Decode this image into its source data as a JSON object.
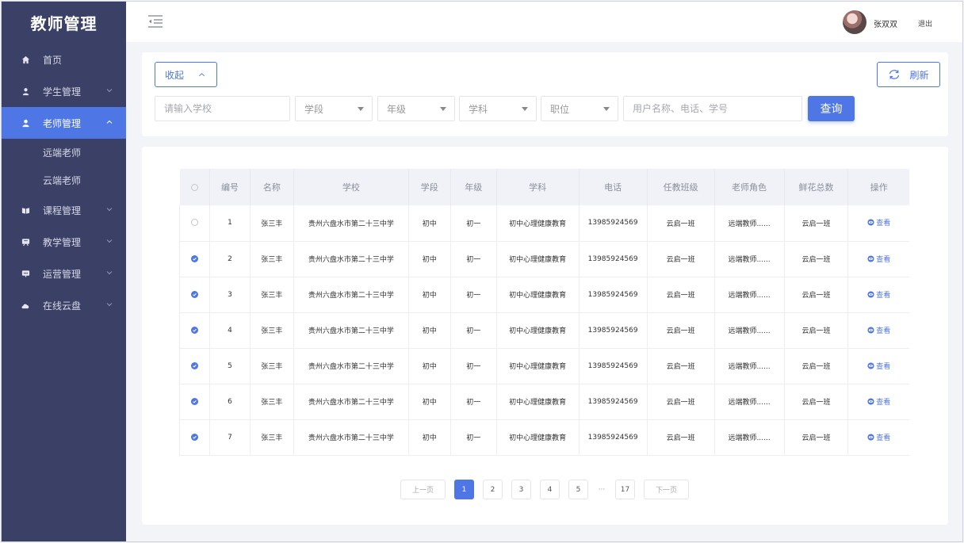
{
  "sidebar": {
    "brand": "教师管理",
    "items": [
      {
        "label": "首页"
      },
      {
        "label": "学生管理"
      },
      {
        "label": "老师管理"
      },
      {
        "label": "课程管理"
      },
      {
        "label": "教学管理"
      },
      {
        "label": "运营管理"
      },
      {
        "label": "在线云盘"
      }
    ],
    "subitems": [
      {
        "label": "远端老师"
      },
      {
        "label": "云端老师"
      }
    ]
  },
  "topbar": {
    "username": "张双双",
    "logout": "退出"
  },
  "filters": {
    "collapse_label": "收起",
    "refresh_label": "刷新",
    "school_placeholder": "请输入学校",
    "stage": "学段",
    "grade": "年级",
    "subject": "学科",
    "position": "职位",
    "keyword_placeholder": "用户名称、电话、学号",
    "search_label": "查询"
  },
  "table": {
    "headers": [
      "编号",
      "名称",
      "学校",
      "学段",
      "年级",
      "学科",
      "电话",
      "任教班级",
      "老师角色",
      "鲜花总数",
      "操作"
    ],
    "rows": [
      {
        "checked": false,
        "id": "1",
        "name": "张三丰",
        "school": "贵州六盘水市第二十三中学",
        "stage": "初中",
        "grade": "初一",
        "subject": "初中心理健康教育",
        "phone": "13985924569",
        "class": "云启一班",
        "role": "远端教师......",
        "flowers": "云启一班",
        "action": "查看"
      },
      {
        "checked": true,
        "id": "2",
        "name": "张三丰",
        "school": "贵州六盘水市第二十三中学",
        "stage": "初中",
        "grade": "初一",
        "subject": "初中心理健康教育",
        "phone": "13985924569",
        "class": "云启一班",
        "role": "远端教师......",
        "flowers": "云启一班",
        "action": "查看"
      },
      {
        "checked": true,
        "id": "3",
        "name": "张三丰",
        "school": "贵州六盘水市第二十三中学",
        "stage": "初中",
        "grade": "初一",
        "subject": "初中心理健康教育",
        "phone": "13985924569",
        "class": "云启一班",
        "role": "远端教师......",
        "flowers": "云启一班",
        "action": "查看"
      },
      {
        "checked": true,
        "id": "4",
        "name": "张三丰",
        "school": "贵州六盘水市第二十三中学",
        "stage": "初中",
        "grade": "初一",
        "subject": "初中心理健康教育",
        "phone": "13985924569",
        "class": "云启一班",
        "role": "远端教师......",
        "flowers": "云启一班",
        "action": "查看"
      },
      {
        "checked": true,
        "id": "5",
        "name": "张三丰",
        "school": "贵州六盘水市第二十三中学",
        "stage": "初中",
        "grade": "初一",
        "subject": "初中心理健康教育",
        "phone": "13985924569",
        "class": "云启一班",
        "role": "远端教师......",
        "flowers": "云启一班",
        "action": "查看"
      },
      {
        "checked": true,
        "id": "6",
        "name": "张三丰",
        "school": "贵州六盘水市第二十三中学",
        "stage": "初中",
        "grade": "初一",
        "subject": "初中心理健康教育",
        "phone": "13985924569",
        "class": "云启一班",
        "role": "远端教师......",
        "flowers": "云启一班",
        "action": "查看"
      },
      {
        "checked": true,
        "id": "7",
        "name": "张三丰",
        "school": "贵州六盘水市第二十三中学",
        "stage": "初中",
        "grade": "初一",
        "subject": "初中心理健康教育",
        "phone": "13985924569",
        "class": "云启一班",
        "role": "远端教师......",
        "flowers": "云启一班",
        "action": "查看"
      }
    ]
  },
  "pagination": {
    "prev": "上一页",
    "pages": [
      "1",
      "2",
      "3",
      "4",
      "5"
    ],
    "dots": "···",
    "last": "17",
    "next": "下一页",
    "current": "1"
  },
  "colors": {
    "accent": "#4e76e4",
    "sidebar_bg": "#3b4166"
  }
}
